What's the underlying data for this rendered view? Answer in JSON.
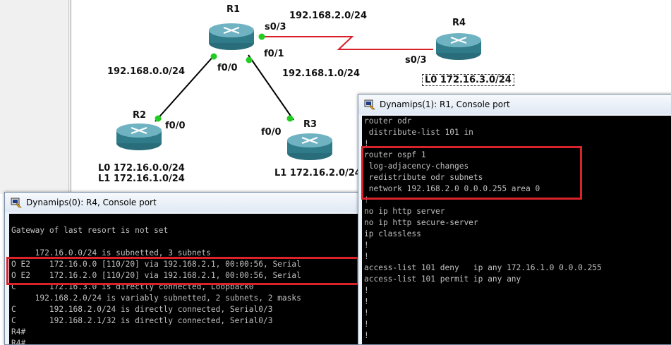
{
  "topology": {
    "routers": [
      {
        "name": "R1"
      },
      {
        "name": "R2"
      },
      {
        "name": "R3"
      },
      {
        "name": "R4"
      }
    ],
    "labels": {
      "r1": "R1",
      "r2": "R2",
      "r3": "R3",
      "r4": "R4",
      "r1_s03": "s0/3",
      "r1_f01": "f0/1",
      "r1_f00": "f0/0",
      "r2_f00": "f0/0",
      "r3_f00": "f0/0",
      "r4_s03": "s0/3",
      "net_r1_r4": "192.168.2.0/24",
      "net_r1_r2": "192.168.0.0/24",
      "net_r1_r3": "192.168.1.0/24",
      "r4_loopback": "L0 172.16.3.0/24",
      "r2_l0": "L0 172.16.0.0/24",
      "r2_l1": "L1 172.16.1.0/24",
      "r3_l1": "L1 172.16.2.0/24"
    },
    "colors": {
      "serial_link": "#d8202a",
      "ethernet_link": "#000000",
      "port_dot": "#22cc22",
      "router_body": "#3b8a9a"
    }
  },
  "windows": {
    "r4": {
      "icon": "dynamips-putty-icon",
      "title": "Dynamips(0): R4, Console port",
      "lines": [
        "",
        "Gateway of last resort is not set",
        "",
        "     172.16.0.0/24 is subnetted, 3 subnets",
        "O E2    172.16.0.0 [110/20] via 192.168.2.1, 00:00:56, Serial",
        "O E2    172.16.2.0 [110/20] via 192.168.2.1, 00:00:56, Serial",
        "C       172.16.3.0 is directly connected, Loopback0",
        "     192.168.2.0/24 is variably subnetted, 2 subnets, 2 masks",
        "C       192.168.2.0/24 is directly connected, Serial0/3",
        "C       192.168.2.1/32 is directly connected, Serial0/3",
        "R4#",
        "R4#"
      ]
    },
    "r1": {
      "icon": "dynamips-putty-icon",
      "title": "Dynamips(1): R1, Console port",
      "lines": [
        "router odr",
        " distribute-list 101 in",
        "!",
        "router ospf 1",
        " log-adjacency-changes",
        " redistribute odr subnets",
        " network 192.168.2.0 0.0.0.255 area 0",
        "!",
        "no ip http server",
        "no ip http secure-server",
        "ip classless",
        "!",
        "!",
        "access-list 101 deny   ip any 172.16.1.0 0.0.0.255",
        "access-list 101 permit ip any any",
        "!",
        "!",
        "!",
        "!",
        "!"
      ]
    }
  },
  "highlight_color": "#d9222a"
}
